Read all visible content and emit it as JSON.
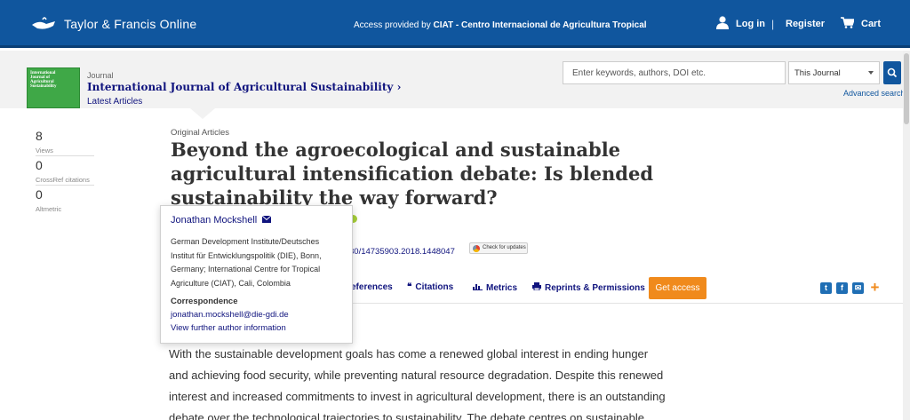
{
  "header": {
    "brand": "Taylor & Francis Online",
    "access_prefix": "Access provided by",
    "access_org": "CIAT - Centro Internacional de Agricultura Tropical",
    "login": "Log in",
    "separator": "|",
    "register": "Register",
    "cart": "Cart",
    "colors": {
      "bar": "#10569e"
    }
  },
  "journal": {
    "label": "Journal",
    "title": "International Journal of Agricultural Sustainability",
    "latest": "Latest Articles",
    "cover_text": "International Journal of Agricultural Sustainability"
  },
  "search": {
    "placeholder": "Enter keywords, authors, DOI etc.",
    "scope": "This Journal",
    "advanced": "Advanced search"
  },
  "metrics": [
    {
      "value": "8",
      "label": "Views"
    },
    {
      "value": "0",
      "label": "CrossRef citations"
    },
    {
      "value": "0",
      "label": "Altmetric"
    }
  ],
  "article": {
    "section": "Original Articles",
    "title": "Beyond the agroecological and sustainable agricultural intensification debate: Is blended sustainability the way forward?",
    "doi_fragment": "30/14735903.2018.1448047",
    "check_updates": "Check for updates"
  },
  "tabs": {
    "references": "eferences",
    "citations": "Citations",
    "metrics": "Metrics",
    "reprints": "Reprints & Permissions",
    "get_access": "Get access",
    "accent": "#f08a1c"
  },
  "author_popover": {
    "name": "Jonathan Mockshell",
    "affiliation": "German Development Institute/Deutsches Institut für Entwicklungspolitik (DIE), Bonn, Germany; International Centre for Tropical Agriculture (CIAT), Cali, Colombia",
    "correspondence_label": "Correspondence",
    "email": "jonathan.mockshell@die-gdi.de",
    "more": "View further author information"
  },
  "abstract": "With the sustainable development goals has come a renewed global interest in ending hunger and achieving food security, while preventing natural resource degradation. Despite this renewed interest and increased commitments to invest in agricultural development, there is an outstanding debate over the technological trajectories to sustainability. The debate centres on sustainable"
}
